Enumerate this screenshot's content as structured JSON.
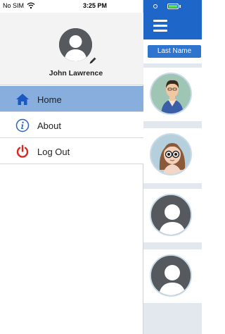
{
  "status_bar": {
    "carrier": "No SIM",
    "time": "3:25 PM"
  },
  "drawer": {
    "user_name": "John Lawrence",
    "menu": [
      {
        "label": "Home",
        "icon": "home-icon",
        "selected": true
      },
      {
        "label": "About",
        "icon": "info-icon",
        "selected": false
      },
      {
        "label": "Log Out",
        "icon": "power-icon",
        "selected": false
      }
    ]
  },
  "background": {
    "sort_button_label": "Last Name"
  },
  "colors": {
    "nav_blue": "#1f66c9",
    "selected_item": "#87aedc",
    "logout_red": "#e0231c",
    "about_blue": "#2a63c4",
    "home_blue": "#1c58c1"
  }
}
